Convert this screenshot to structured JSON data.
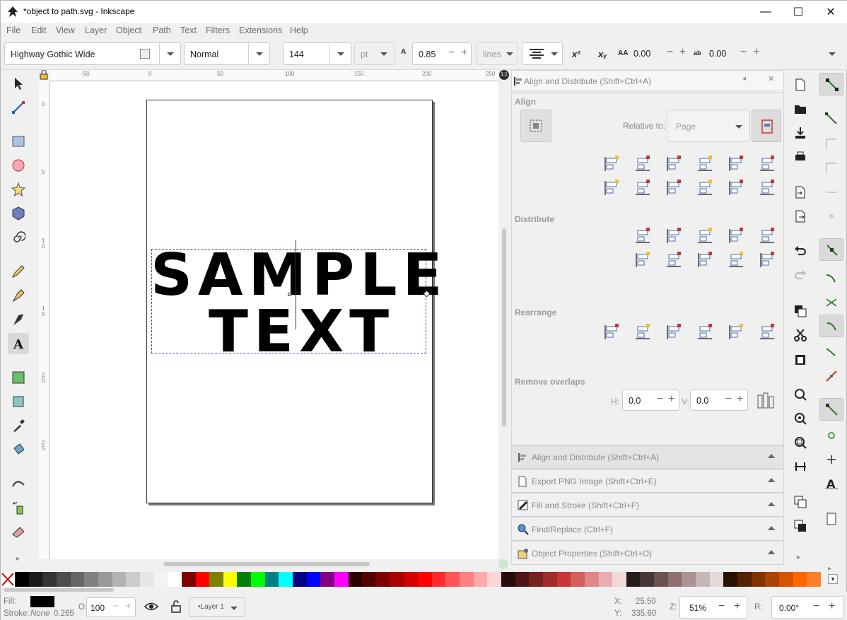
{
  "window": {
    "title": "*object to path.svg - Inkscape"
  },
  "menu": [
    "File",
    "Edit",
    "View",
    "Layer",
    "Object",
    "Path",
    "Text",
    "Filters",
    "Extensions",
    "Help"
  ],
  "toolcontrols": {
    "font_family": "Highway Gothic Wide",
    "font_style": "Normal",
    "font_size": "144",
    "unit": "pt",
    "line_height": "0.85",
    "line_unit": "lines",
    "superscript": "x²",
    "subscript": "xᵧ",
    "letter_spacing": "0.00",
    "word_spacing": "0.00"
  },
  "ruler": {
    "h": [
      "-50",
      "0",
      "50",
      "100",
      "150",
      "200",
      "250"
    ],
    "v": [
      "0",
      "5",
      "1 0",
      "1 5",
      "2 0",
      "2 5"
    ]
  },
  "canvas": {
    "line1": "SAMPLE",
    "line2": "TEXT"
  },
  "dock": {
    "title": "Align and Distribute (Shift+Ctrl+A)",
    "align_label": "Align",
    "relative_label": "Relative to:",
    "relative_value": "Page",
    "distribute_label": "Distribute",
    "rearrange_label": "Rearrange",
    "overlaps_label": "Remove overlaps",
    "h_label": "H:",
    "h_value": "0.0",
    "v_label": "V:",
    "v_value": "0.0",
    "panels": [
      "Align and Distribute (Shift+Ctrl+A)",
      "Export PNG Image (Shift+Ctrl+E)",
      "Fill and Stroke (Shift+Ctrl+F)",
      "Find/Replace (Ctrl+F)",
      "Object Properties (Shift+Ctrl+O)"
    ]
  },
  "palette": [
    "#000000",
    "#1a1a1a",
    "#333333",
    "#4d4d4d",
    "#666666",
    "#808080",
    "#999999",
    "#b3b3b3",
    "#cccccc",
    "#e6e6e6",
    "#f2f2f2",
    "#ffffff",
    "#800000",
    "#ff0000",
    "#808000",
    "#ffff00",
    "#008000",
    "#00ff00",
    "#008080",
    "#00ffff",
    "#000080",
    "#0000ff",
    "#800080",
    "#ff00ff",
    "#2b0000",
    "#550000",
    "#800000",
    "#aa0000",
    "#d40000",
    "#ff0000",
    "#ff2a2a",
    "#ff5555",
    "#ff8080",
    "#ffaaaa",
    "#ffd5d5",
    "#280b0b",
    "#501616",
    "#782121",
    "#a02c2c",
    "#c83737",
    "#d35f5f",
    "#de8787",
    "#e9afaf",
    "#f4d7d7",
    "#241c1c",
    "#483737",
    "#6c5353",
    "#916f6f",
    "#ac9393",
    "#c8b7b7",
    "#e3dbdb",
    "#2b1100",
    "#552200",
    "#803300",
    "#aa4400",
    "#d45500",
    "#ff6600",
    "#ff7f2a"
  ],
  "status": {
    "fill_label": "Fill:",
    "stroke_label": "Stroke:",
    "stroke_value": "None",
    "stroke_width": "0.265",
    "opacity_label": "O:",
    "opacity_value": "100",
    "layer": "•Layer 1",
    "x_label": "X:",
    "x_value": "25.50",
    "y_label": "Y:",
    "y_value": "335.60",
    "zoom_label": "Z:",
    "zoom_value": "51%",
    "rotate_label": "R:",
    "rotate_value": "0.00°"
  },
  "colors": {
    "fill": "#000000",
    "accent_red": "#cc3333"
  }
}
